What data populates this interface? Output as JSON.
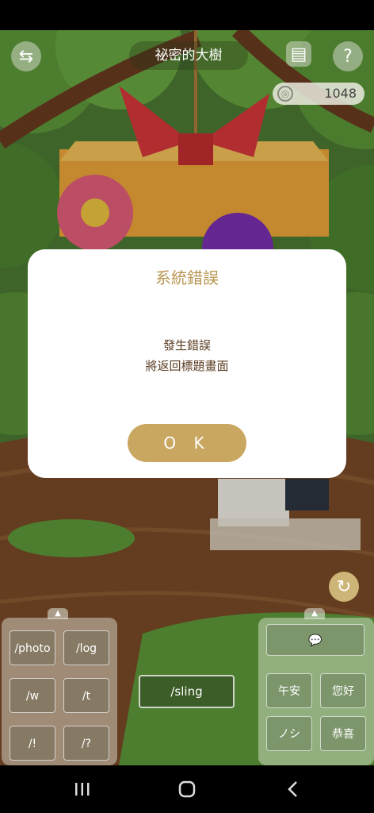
{
  "header": {
    "title": "祕密的大樹"
  },
  "coins": {
    "value": "1048"
  },
  "left_commands": [
    "/photo",
    "/log",
    "/w",
    "/t",
    "/!",
    "/?"
  ],
  "center_command": "/sling",
  "right_commands": [
    "午安",
    "您好",
    "ノシ",
    "恭喜"
  ],
  "dialog": {
    "title": "系統錯誤",
    "message_line1": "發生錯誤",
    "message_line2": "將返回標題畫面",
    "ok_label": "O K"
  },
  "icons": {
    "back": "back-map-icon",
    "log": "log-icon",
    "help": "help-icon",
    "coin": "coin-icon",
    "chat": "chat-bubble-icon",
    "refresh": "refresh-icon"
  },
  "colors": {
    "accent": "#c9a761",
    "title": "#b99550",
    "message": "#5a3c22"
  }
}
